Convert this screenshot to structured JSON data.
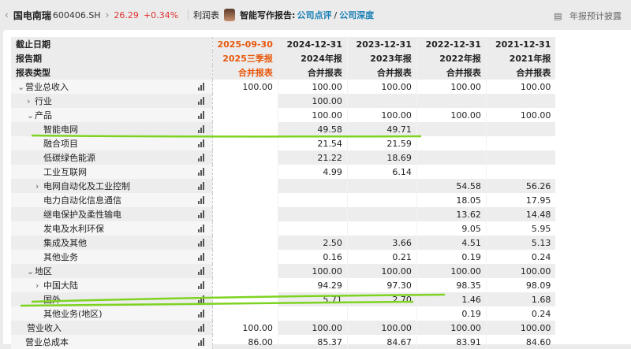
{
  "header": {
    "back": "‹",
    "name": "国电南瑞",
    "code": "600406.SH",
    "forward": "›",
    "price": "26.29",
    "change": "+0.34%",
    "statement": "利润表",
    "ai_label": "智能写作报告:",
    "link1": "公司点评",
    "slash": "/",
    "link2": "公司深度",
    "right_label": "年报预计披露"
  },
  "table": {
    "header_rows": [
      {
        "label": "截止日期",
        "values": [
          "2025-09-30",
          "2024-12-31",
          "2023-12-31",
          "2022-12-31",
          "2021-12-31"
        ]
      },
      {
        "label": "报告期",
        "values": [
          "2025三季报",
          "2024年报",
          "2023年报",
          "2022年报",
          "2021年报"
        ]
      },
      {
        "label": "报表类型",
        "values": [
          "合并报表",
          "合并报表",
          "合并报表",
          "合并报表",
          "合并报表"
        ]
      }
    ],
    "rows": [
      {
        "label": "营业总收入",
        "level": 0,
        "toggle": "expanded",
        "values": [
          "100.00",
          "100.00",
          "100.00",
          "100.00",
          "100.00"
        ]
      },
      {
        "label": "行业",
        "level": 1,
        "toggle": "collapsed",
        "values": [
          "",
          "100.00",
          "",
          "",
          ""
        ]
      },
      {
        "label": "产品",
        "level": 1,
        "toggle": "expanded",
        "values": [
          "",
          "100.00",
          "100.00",
          "100.00",
          "100.00"
        ]
      },
      {
        "label": "智能电网",
        "level": 2,
        "toggle": "",
        "values": [
          "",
          "49.58",
          "49.71",
          "",
          ""
        ]
      },
      {
        "label": "融合项目",
        "level": 2,
        "toggle": "",
        "values": [
          "",
          "21.54",
          "21.59",
          "",
          ""
        ]
      },
      {
        "label": "低碳绿色能源",
        "level": 2,
        "toggle": "",
        "values": [
          "",
          "21.22",
          "18.69",
          "",
          ""
        ]
      },
      {
        "label": "工业互联网",
        "level": 2,
        "toggle": "",
        "values": [
          "",
          "4.99",
          "6.14",
          "",
          ""
        ]
      },
      {
        "label": "电网自动化及工业控制",
        "level": 2,
        "toggle": "collapsed",
        "values": [
          "",
          "",
          "",
          "54.58",
          "56.26"
        ]
      },
      {
        "label": "电力自动化信息通信",
        "level": 2,
        "toggle": "",
        "values": [
          "",
          "",
          "",
          "18.05",
          "17.95"
        ]
      },
      {
        "label": "继电保护及柔性输电",
        "level": 2,
        "toggle": "",
        "values": [
          "",
          "",
          "",
          "13.62",
          "14.48"
        ]
      },
      {
        "label": "发电及水利环保",
        "level": 2,
        "toggle": "",
        "values": [
          "",
          "",
          "",
          "9.05",
          "5.95"
        ]
      },
      {
        "label": "集成及其他",
        "level": 2,
        "toggle": "",
        "values": [
          "",
          "2.50",
          "3.66",
          "4.51",
          "5.13"
        ]
      },
      {
        "label": "其他业务",
        "level": 2,
        "toggle": "",
        "values": [
          "",
          "0.16",
          "0.21",
          "0.19",
          "0.24"
        ]
      },
      {
        "label": "地区",
        "level": 1,
        "toggle": "expanded",
        "values": [
          "",
          "100.00",
          "100.00",
          "100.00",
          "100.00"
        ]
      },
      {
        "label": "中国大陆",
        "level": 2,
        "toggle": "collapsed",
        "values": [
          "",
          "94.29",
          "97.30",
          "98.35",
          "98.09"
        ]
      },
      {
        "label": "国外",
        "level": 2,
        "toggle": "",
        "values": [
          "",
          "5.71",
          "2.70",
          "1.46",
          "1.68"
        ]
      },
      {
        "label": "其他业务(地区)",
        "level": 2,
        "toggle": "",
        "values": [
          "",
          "",
          "",
          "0.19",
          "0.24"
        ]
      },
      {
        "label": "营业收入",
        "level": 1,
        "toggle": "",
        "values": [
          "100.00",
          "100.00",
          "100.00",
          "100.00",
          "100.00"
        ]
      },
      {
        "label": "营业总成本",
        "level": 0,
        "toggle": "",
        "values": [
          "86.00",
          "85.37",
          "84.67",
          "83.91",
          "84.60"
        ]
      }
    ]
  },
  "annotation_color": "#7ed321"
}
